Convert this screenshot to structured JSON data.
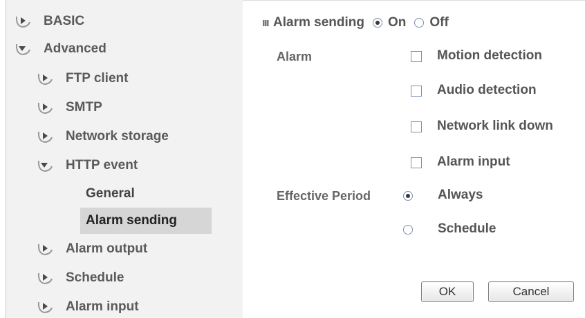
{
  "sidebar": {
    "items": [
      {
        "label": "BASIC",
        "expanded": false
      },
      {
        "label": "Advanced",
        "expanded": true
      },
      {
        "label": "FTP client",
        "expanded": false
      },
      {
        "label": "SMTP",
        "expanded": false
      },
      {
        "label": "Network storage",
        "expanded": false
      },
      {
        "label": "HTTP event",
        "expanded": true
      },
      {
        "label": "Alarm output",
        "expanded": false
      },
      {
        "label": "Schedule",
        "expanded": false
      },
      {
        "label": "Alarm input",
        "expanded": false
      }
    ],
    "sub_items": [
      {
        "label": "General",
        "active": false
      },
      {
        "label": "Alarm sending",
        "active": true
      }
    ]
  },
  "form": {
    "alarm_sending": {
      "label": "Alarm sending",
      "on_label": "On",
      "off_label": "Off",
      "selected": "On"
    },
    "alarm": {
      "label": "Alarm",
      "options": [
        {
          "label": "Motion detection",
          "checked": false
        },
        {
          "label": "Audio detection",
          "checked": false
        },
        {
          "label": "Network link down",
          "checked": false
        },
        {
          "label": "Alarm input",
          "checked": false
        }
      ]
    },
    "effective_period": {
      "label": "Effective Period",
      "options": [
        {
          "label": "Always",
          "selected": true
        },
        {
          "label": "Schedule",
          "selected": false
        }
      ]
    },
    "buttons": {
      "ok_label": "OK",
      "cancel_label": "Cancel"
    }
  },
  "icons": {
    "collapsed_arrow": "chevron-right-icon",
    "expanded_arrow": "chevron-down-icon"
  },
  "colors": {
    "sidebar_bg": "#f2f2f2",
    "active_item_bg": "#d6d6d6",
    "text": "#555555",
    "control_border": "#7a8fb0"
  }
}
